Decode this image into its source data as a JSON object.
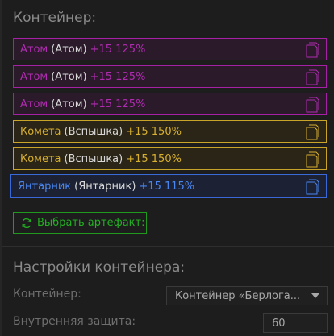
{
  "container_section": {
    "title": "Контейнер:",
    "artifacts": [
      {
        "name": "Атом",
        "original": "(Атом)",
        "bonus": "+15 125%",
        "rarity_color": "#b02cb0"
      },
      {
        "name": "Атом",
        "original": "(Атом)",
        "bonus": "+15 125%",
        "rarity_color": "#b02cb0"
      },
      {
        "name": "Атом",
        "original": "(Атом)",
        "bonus": "+15 125%",
        "rarity_color": "#b02cb0"
      },
      {
        "name": "Комета",
        "original": "(Вспышка)",
        "bonus": "+15 150%",
        "rarity_color": "#d8b030"
      },
      {
        "name": "Комета",
        "original": "(Вспышка)",
        "bonus": "+15 150%",
        "rarity_color": "#d8b030"
      },
      {
        "name": "Янтарник",
        "original": "(Янтарник)",
        "bonus": "+15 115%",
        "rarity_color": "#4a86f0"
      }
    ],
    "copy_icon": "copy-document-icon",
    "select_button": {
      "label": "Выбрать артефакт:",
      "icon": "refresh-icon",
      "color": "#22b022"
    }
  },
  "settings_section": {
    "title": "Настройки контейнера:",
    "container_label": "Контейнер:",
    "container_value": "Контейнер «Берлога...",
    "protection_label": "Внутренняя защита:",
    "protection_value": "60"
  }
}
